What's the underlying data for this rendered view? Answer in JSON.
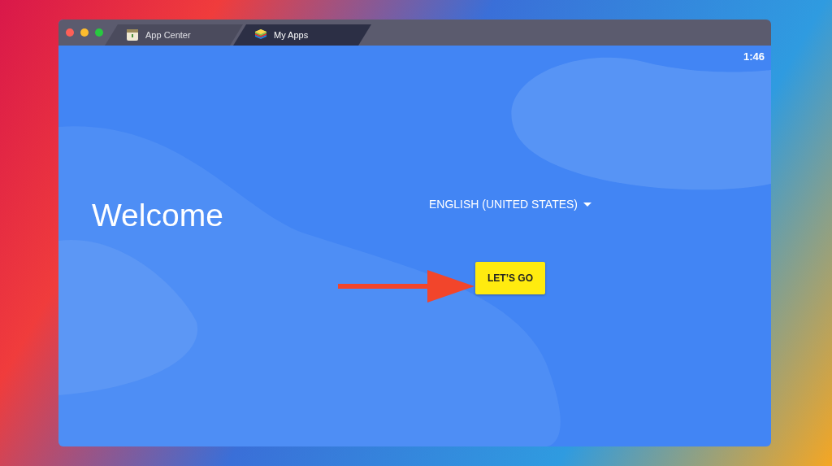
{
  "window": {
    "tabs": [
      {
        "label": "App Center",
        "selected": false
      },
      {
        "label": "My Apps",
        "selected": true
      }
    ]
  },
  "status_bar": {
    "time": "1:46"
  },
  "welcome": {
    "title": "Welcome",
    "language": "ENGLISH (UNITED STATES)",
    "button": "LET’S GO"
  }
}
